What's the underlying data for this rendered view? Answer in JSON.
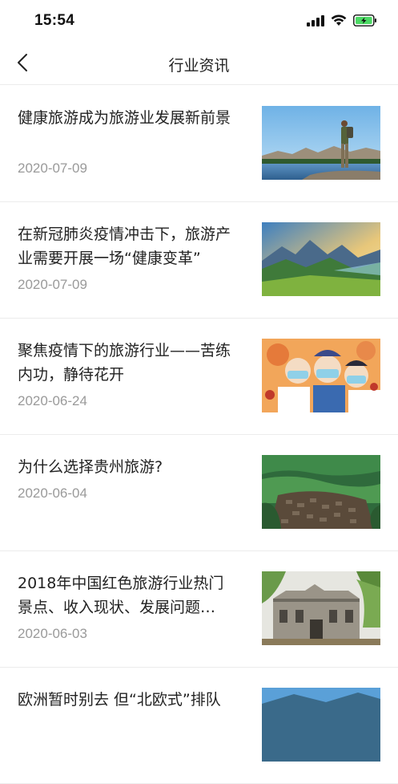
{
  "status_bar": {
    "time": "15:54",
    "icons": [
      "cellular-signal-icon",
      "wifi-icon",
      "battery-charging-icon"
    ],
    "battery_color": "#4cd964"
  },
  "nav": {
    "title": "行业资讯",
    "back_icon": "chevron-left-icon"
  },
  "articles": [
    {
      "title": "健康旅游成为旅游业发展新前景",
      "date": "2020-07-09",
      "thumbnail": "hiker-lake-photo"
    },
    {
      "title": "在新冠肺炎疫情冲击下，旅游产业需要开展一场“健康变革”",
      "date": "2020-07-09",
      "thumbnail": "mountain-valley-photo"
    },
    {
      "title": "聚焦疫情下的旅游行业——苦练内功，静待花开",
      "date": "2020-06-24",
      "thumbnail": "cartoon-medics-illustration"
    },
    {
      "title": "为什么选择贵州旅游?",
      "date": "2020-06-04",
      "thumbnail": "village-aerial-photo"
    },
    {
      "title": "2018年中国红色旅游行业热门景点、收入现状、发展问题…",
      "date": "2020-06-03",
      "thumbnail": "old-building-photo"
    },
    {
      "title": "欧洲暂时别去 但“北欧式”排队",
      "date": "",
      "thumbnail": "landscape-photo"
    }
  ],
  "colors": {
    "divider": "#ececec",
    "date_text": "#9a9a9a",
    "title_text": "#222222"
  }
}
